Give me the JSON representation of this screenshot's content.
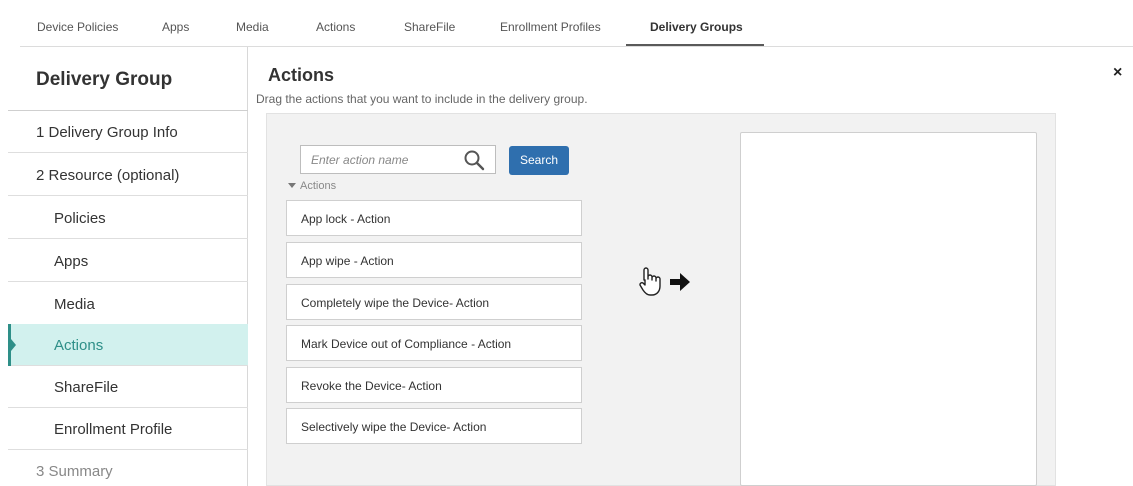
{
  "top_tabs": [
    {
      "label": "Device Policies"
    },
    {
      "label": "Apps"
    },
    {
      "label": "Media"
    },
    {
      "label": "Actions"
    },
    {
      "label": "ShareFile"
    },
    {
      "label": "Enrollment Profiles"
    },
    {
      "label": "Delivery Groups",
      "active": true
    }
  ],
  "sidebar": {
    "title": "Delivery Group",
    "items": [
      {
        "label": "1  Delivery Group Info"
      },
      {
        "label": "2  Resource (optional)"
      },
      {
        "label": "Policies"
      },
      {
        "label": "Apps"
      },
      {
        "label": "Media"
      },
      {
        "label": "Actions",
        "active": true
      },
      {
        "label": "ShareFile"
      },
      {
        "label": "Enrollment Profile"
      },
      {
        "label": "3  Summary"
      }
    ]
  },
  "main": {
    "title": "Actions",
    "subtitle": "Drag the actions that you want to include in the delivery group.",
    "close_label": "×",
    "search": {
      "placeholder": "Enter action name",
      "value": ""
    },
    "search_button": "Search",
    "group_label": "Actions",
    "actions": [
      "App lock - Action",
      "App wipe - Action",
      "Completely wipe the Device- Action",
      "Mark Device out of Compliance - Action",
      "Revoke the Device- Action",
      "Selectively wipe the Device- Action"
    ]
  },
  "colors": {
    "accent": "#2e8f88",
    "active_bg": "#d2f1ee",
    "button": "#2f6fae"
  },
  "icons": [
    "search-icon",
    "pointer-hand-icon",
    "right-arrow-icon",
    "close-icon",
    "caret-down-icon"
  ]
}
